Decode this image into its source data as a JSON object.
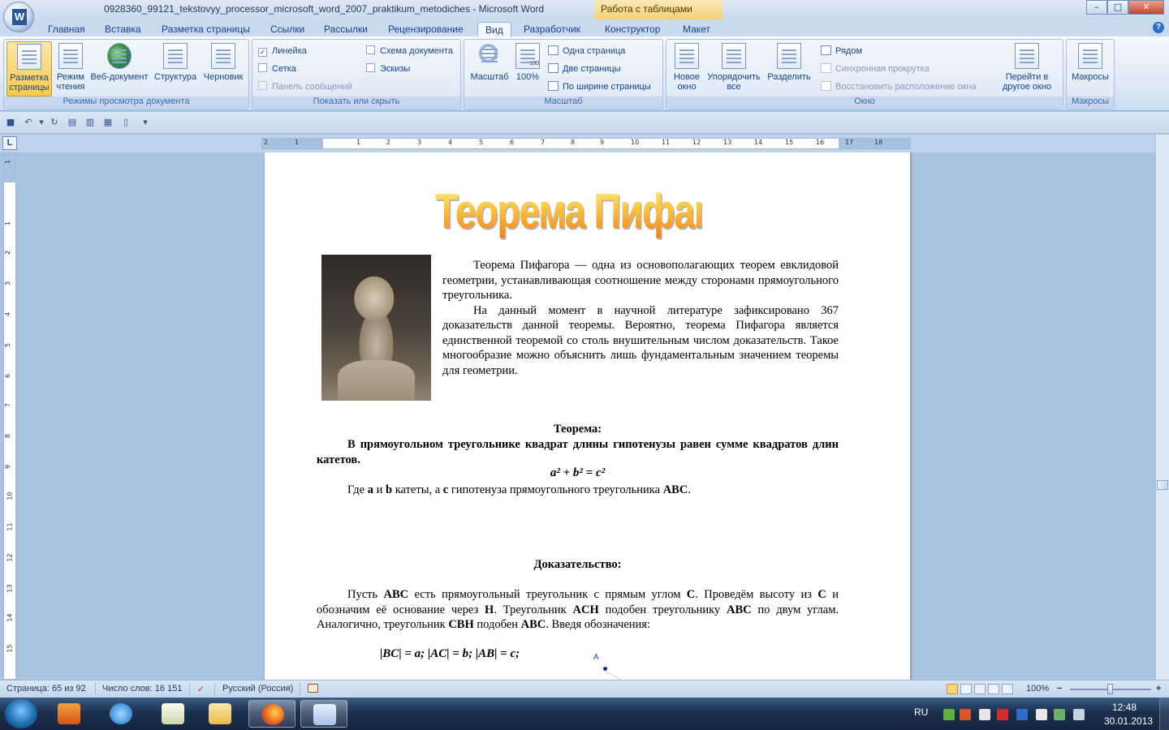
{
  "window": {
    "title": "0928360_99121_tekstovyy_processor_microsoft_word_2007_praktikum_metodiches - Microsoft Word",
    "context_tab_group": "Работа с таблицами",
    "minimize": "–",
    "maximize": "□",
    "close": "✕"
  },
  "tabs": [
    {
      "label": "Главная"
    },
    {
      "label": "Вставка"
    },
    {
      "label": "Разметка страницы"
    },
    {
      "label": "Ссылки"
    },
    {
      "label": "Рассылки"
    },
    {
      "label": "Рецензирование"
    },
    {
      "label": "Вид",
      "active": true
    },
    {
      "label": "Разработчик"
    },
    {
      "label": "Конструктор"
    },
    {
      "label": "Макет"
    }
  ],
  "ribbon": {
    "views_group": {
      "label": "Режимы просмотра документа",
      "buttons": [
        {
          "label1": "Разметка",
          "label2": "страницы"
        },
        {
          "label1": "Режим",
          "label2": "чтения"
        },
        {
          "label1": "Веб-документ",
          "label2": ""
        },
        {
          "label1": "Структура",
          "label2": ""
        },
        {
          "label1": "Черновик",
          "label2": ""
        }
      ]
    },
    "show_group": {
      "label": "Показать или скрыть",
      "ruler": "Линейка",
      "grid": "Сетка",
      "message_bar": "Панель сообщений",
      "doc_map": "Схема документа",
      "thumbnails": "Эскизы",
      "checked_mark": "✓"
    },
    "zoom_group": {
      "label": "Масштаб",
      "zoom": "Масштаб",
      "hundred": "100%",
      "hundred_icon": "100",
      "one_page": "Одна страница",
      "two_pages": "Две страницы",
      "page_width": "По ширине страницы"
    },
    "window_group": {
      "label": "Окно",
      "new_window1": "Новое",
      "new_window2": "окно",
      "arrange1": "Упорядочить",
      "arrange2": "все",
      "split": "Разделить",
      "side_by_side": "Рядом",
      "sync_scroll": "Синхронная прокрутка",
      "reset_position": "Восстановить расположение окна",
      "switch1": "Перейти в",
      "switch2": "другое окно"
    },
    "macros_group": {
      "label": "Макросы",
      "macros": "Макросы"
    }
  },
  "ruler": {
    "corner": "L",
    "numbers": [
      "2",
      "1",
      "1",
      "2",
      "3",
      "4",
      "5",
      "6",
      "7",
      "8",
      "9",
      "10",
      "11",
      "12",
      "13",
      "14",
      "15",
      "16",
      "17",
      "18"
    ],
    "vnumbers": [
      "1",
      "1",
      "2",
      "3",
      "4",
      "5",
      "6",
      "7",
      "8",
      "9",
      "10",
      "11",
      "12",
      "13",
      "14",
      "15"
    ]
  },
  "document": {
    "wordart_title": "Теорема Пифагора",
    "intro_p1": "Теорема Пифагора — одна из основополагающих теорем евклидовой геометрии, устанавливающая соотношение между сторонами прямоугольного треугольника.",
    "intro_p2": "На данный момент в научной литературе зафиксировано 367 доказательств данной теоремы. Вероятно, теорема Пифагора является единственной теоремой со столь внушительным числом доказательств. Такое многообразие можно объяснить лишь фундаментальным значением теоремы для геометрии.",
    "theorem_heading": "Теорема:",
    "theorem_text": "В прямоугольном треугольнике квадрат длины гипотенузы равен сумме квадратов длин катетов.",
    "formula": "a² + b² = c²",
    "where_line_1": "Где ",
    "where_a": "a",
    "where_and": " и ",
    "where_b": "b",
    "where_mid": " катеты, а ",
    "where_c": "c",
    "where_end": " гипотенуза прямоугольного треугольника ",
    "where_abc": "ABC",
    "where_dot": ".",
    "proof_heading": "Доказательство:",
    "proof_s1": "Пусть ",
    "proof_abc": "ABC",
    "proof_s2": " есть прямоугольный треугольник с прямым углом ",
    "proof_c": "C",
    "proof_s3": ". Проведём высоту из ",
    "proof_c2": "C",
    "proof_s4": " и обозначим её основание через ",
    "proof_h": "H",
    "proof_s5": ". Треугольник ",
    "proof_ach": "ACH",
    "proof_s6": " подобен треугольнику ",
    "proof_abc2": "ABC",
    "proof_s7": " по двум углам. Аналогично, треугольник ",
    "proof_cbh": "CBH",
    "proof_s8": " подобен ",
    "proof_abc3": "ABC",
    "proof_s9": ". Введя обозначения:",
    "notation": "|BC| = a;  |AC| = b; |AB| = c;",
    "figure_label_a": "A"
  },
  "statusbar": {
    "page": "Страница: 65 из 92",
    "words": "Число слов: 16 151",
    "language": "Русский (Россия)",
    "zoom": "100%",
    "zoom_minus": "−",
    "zoom_plus": "+"
  },
  "taskbar": {
    "lang": "RU",
    "time": "12:48",
    "date": "30.01.2013"
  },
  "colors": {
    "accent": "#15428b",
    "wordart_top": "#fff07a",
    "wordart_bottom": "#f07a18"
  }
}
